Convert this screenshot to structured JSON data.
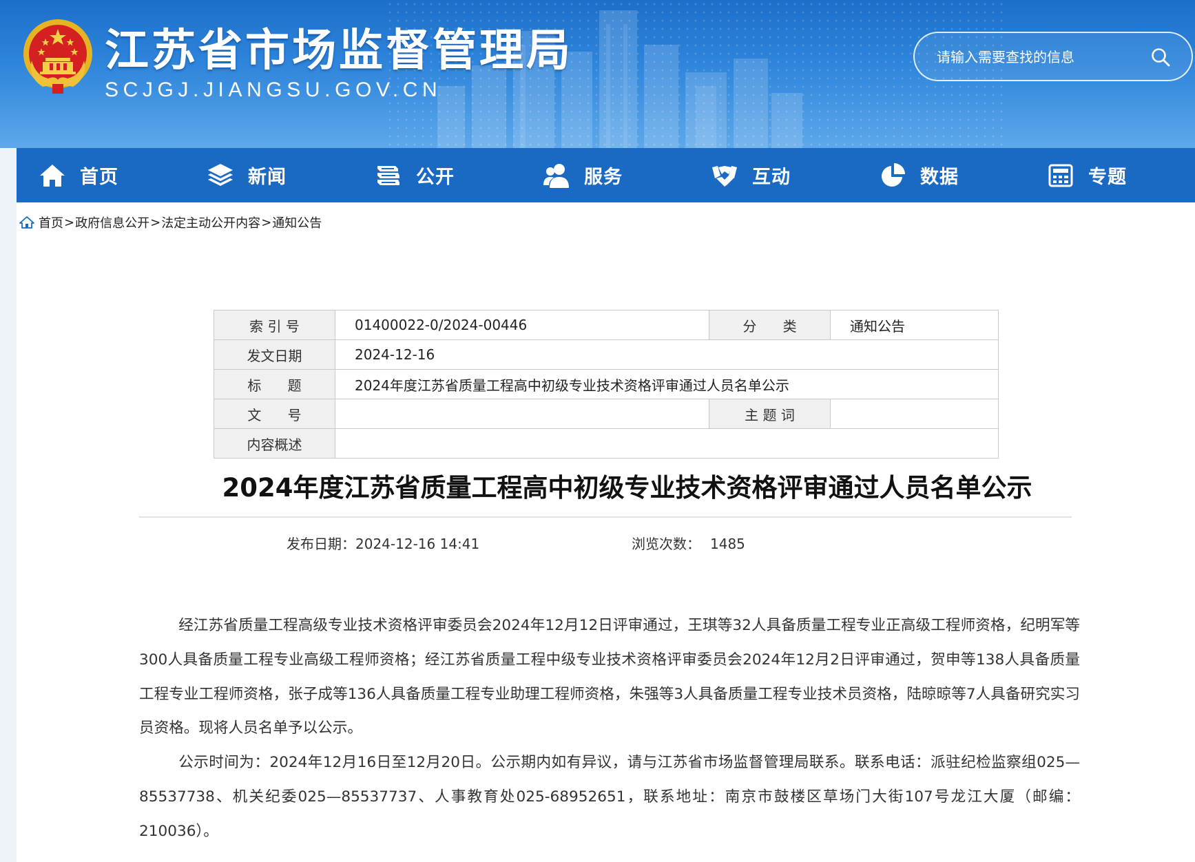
{
  "header": {
    "site_title": "江苏省市场监督管理局",
    "site_domain": "SCJGJ.JIANGSU.GOV.CN",
    "search_placeholder": "请输入需要查找的信息",
    "colors": {
      "header_blue": "#1c6fc9",
      "nav_blue": "#1a6ac3"
    }
  },
  "nav": [
    {
      "label": "首页",
      "icon": "home-icon"
    },
    {
      "label": "新闻",
      "icon": "layers-icon"
    },
    {
      "label": "公开",
      "icon": "book-stack-icon"
    },
    {
      "label": "服务",
      "icon": "users-icon"
    },
    {
      "label": "互动",
      "icon": "handshake-icon"
    },
    {
      "label": "数据",
      "icon": "pie-chart-icon"
    },
    {
      "label": "专题",
      "icon": "calculator-icon"
    }
  ],
  "breadcrumb": {
    "items": [
      "首页",
      "政府信息公开",
      "法定主动公开内容",
      "通知公告"
    ],
    "separator": ">"
  },
  "meta": {
    "index_label": "索 引 号",
    "index_value": "01400022-0/2024-00446",
    "category_label": "分      类",
    "category_value": "通知公告",
    "date_label": "发文日期",
    "date_value": "2024-12-16",
    "title_label": "标      题",
    "title_value": "2024年度江苏省质量工程高中初级专业技术资格评审通过人员名单公示",
    "docno_label": "文      号",
    "docno_value": "",
    "keywords_label": "主 题 词",
    "keywords_value": "",
    "summary_label": "内容概述",
    "summary_value": ""
  },
  "article": {
    "title": "2024年度江苏省质量工程高中初级专业技术资格评审通过人员名单公示",
    "publish_label": "发布日期：",
    "publish_value": "2024-12-16 14:41",
    "views_label": "浏览次数：",
    "views_value": "1485",
    "paragraphs": [
      "经江苏省质量工程高级专业技术资格评审委员会2024年12月12日评审通过，王琪等32人具备质量工程专业正高级工程师资格，纪明军等300人具备质量工程专业高级工程师资格；经江苏省质量工程中级专业技术资格评审委员会2024年12月2日评审通过，贺申等138人具备质量工程专业工程师资格，张子成等136人具备质量工程专业助理工程师资格，朱强等3人具备质量工程专业技术员资格，陆晾晾等7人具备研究实习员资格。现将人员名单予以公示。",
      "公示时间为：2024年12月16日至12月20日。公示期内如有异议，请与江苏省市场监督管理局联系。联系电话：派驻纪检监察组025—85537738、机关纪委025—85537737、人事教育处025-68952651，联系地址：南京市鼓楼区草场门大街107号龙江大厦（邮编：210036）。"
    ]
  }
}
